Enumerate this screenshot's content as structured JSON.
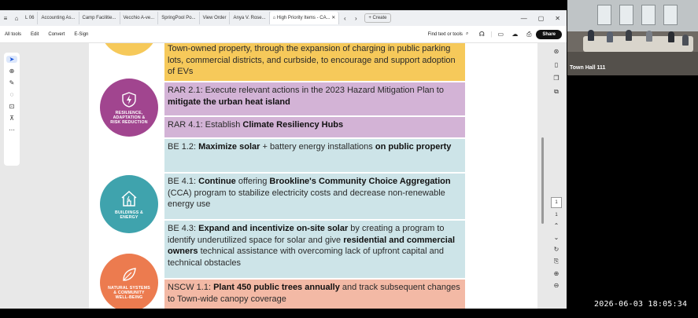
{
  "browser": {
    "tabs": [
      {
        "label": "L 06",
        "active": false
      },
      {
        "label": "Accounting As...",
        "active": false
      },
      {
        "label": "Camp Facilitie...",
        "active": false
      },
      {
        "label": "Vecchio A-ve...",
        "active": false
      },
      {
        "label": "SpringPool Po...",
        "active": false
      },
      {
        "label": "View Order",
        "active": false
      },
      {
        "label": "Anya V. Rose...",
        "active": false
      },
      {
        "label": "High Priority Items - CA...",
        "active": true
      }
    ],
    "new_tab_label": "+ Create"
  },
  "toolbar": {
    "menu": [
      "All tools",
      "Edit",
      "Convert",
      "E-Sign"
    ],
    "search_label": "Find text or tools",
    "share_label": "Share"
  },
  "document": {
    "rows": [
      {
        "segments": [
          {
            "t": "Town-owned property, through the expansion of charging in public parking lots, commercial districts, and curbside, to encourage and support adoption of EVs",
            "b": false
          }
        ]
      },
      {
        "segments": [
          {
            "t": "RAR 2.1: Execute relevant actions in the 2023 Hazard Mitigation Plan to ",
            "b": false
          },
          {
            "t": "mitigate the urban heat island",
            "b": true
          }
        ]
      },
      {
        "segments": [
          {
            "t": "RAR 4.1: Establish ",
            "b": false
          },
          {
            "t": "Climate Resiliency Hubs",
            "b": true
          }
        ]
      },
      {
        "segments": [
          {
            "t": "BE 1.2: ",
            "b": false
          },
          {
            "t": "Maximize solar",
            "b": true
          },
          {
            "t": " + battery energy installations ",
            "b": false
          },
          {
            "t": "on public property",
            "b": true
          }
        ]
      },
      {
        "segments": [
          {
            "t": "BE 4.1: ",
            "b": false
          },
          {
            "t": "Continue",
            "b": true
          },
          {
            "t": " offering ",
            "b": false
          },
          {
            "t": "Brookline's Community Choice Aggregation",
            "b": true
          },
          {
            "t": " (CCA) program to stabilize electricity costs and decrease non-renewable energy use",
            "b": false
          }
        ]
      },
      {
        "segments": [
          {
            "t": "BE 4.3: ",
            "b": false
          },
          {
            "t": "Expand and incentivize on-site solar",
            "b": true
          },
          {
            "t": " by creating a program to identify underutilized space for solar and give ",
            "b": false
          },
          {
            "t": "residential and commercial owners",
            "b": true
          },
          {
            "t": " technical assistance with overcoming lack of upfront capital and technical obstacles",
            "b": false
          }
        ]
      },
      {
        "segments": [
          {
            "t": "NSCW 1.1: ",
            "b": false
          },
          {
            "t": "Plant 450 public trees annually",
            "b": true
          },
          {
            "t": " and track subsequent changes to Town-wide canopy coverage",
            "b": false
          }
        ]
      }
    ],
    "categories": [
      {
        "label_lines": [
          "RESILIENCE,",
          "ADAPTATION &",
          "RISK REDUCTION"
        ],
        "color": "#a1458f"
      },
      {
        "label_lines": [
          "BUILDINGS &",
          "ENERGY"
        ],
        "color": "#3fa3ad"
      },
      {
        "label_lines": [
          "NATURAL SYSTEMS",
          "& COMMUNITY",
          "WELL-BEING"
        ],
        "color": "#ec7b4f"
      }
    ],
    "colors": {
      "transport": "#f6c95a",
      "resilience": "#d3b3d6",
      "energy": "#cde4e8",
      "nature": "#f3b9a5"
    }
  },
  "viewer": {
    "page_number": "1"
  },
  "video": {
    "participant_name": "Town Hall 111"
  },
  "overlay": {
    "timestamp": "2026-06-03 18:05:34"
  }
}
